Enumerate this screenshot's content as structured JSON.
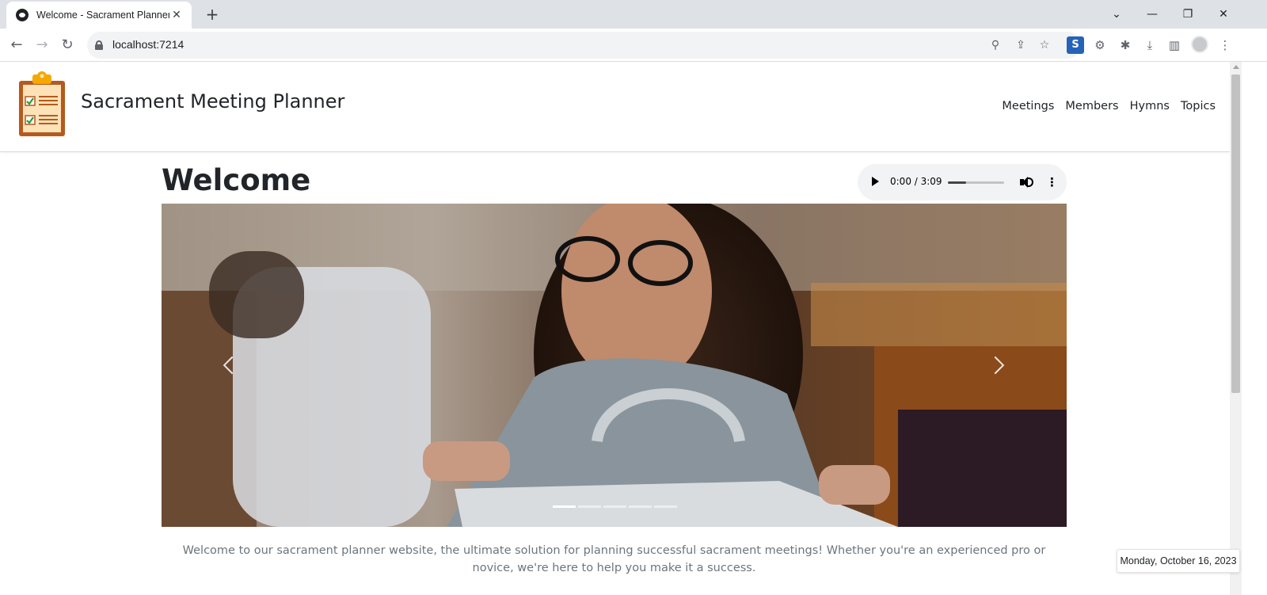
{
  "browser": {
    "tab_title": "Welcome - Sacrament Planner",
    "new_tab_label": "+",
    "url": "localhost:7214"
  },
  "site": {
    "brand": "Sacrament Meeting Planner",
    "nav": [
      "Meetings",
      "Members",
      "Hymns",
      "Topics"
    ]
  },
  "main": {
    "title": "Welcome",
    "audio": {
      "time": "0:00 / 3:09",
      "progress": 0.33
    },
    "carousel": {
      "slide_count": 5,
      "active_index": 0
    },
    "intro": "Welcome to our sacrament planner website, the ultimate solution for planning successful sacrament meetings! Whether you're an experienced pro or novice, we're here to help you make it a success."
  },
  "footer": {
    "date": "Monday, October 16, 2023"
  },
  "colors": {
    "chrome_bg": "#dee1e6",
    "text": "#212529",
    "muted": "#6c757d",
    "audio_bg": "#f1f3f4"
  }
}
